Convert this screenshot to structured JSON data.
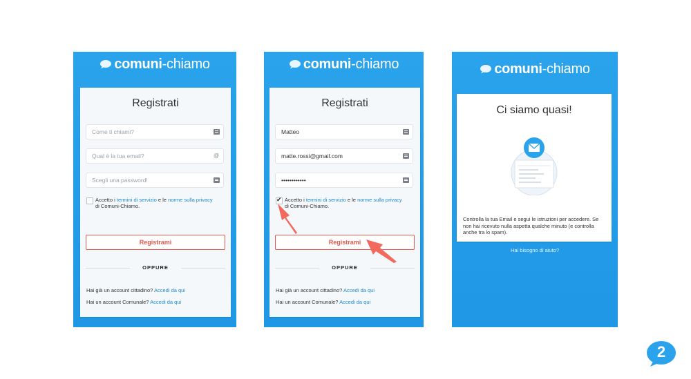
{
  "brand": {
    "part1": "comuni",
    "part2": "-chiamo"
  },
  "screen1": {
    "title": "Registrati",
    "name_placeholder": "Come ti chiami?",
    "email_placeholder": "Qual è la tua email?",
    "password_placeholder": "Scegli una password!",
    "terms_prefix": "Accetto i ",
    "terms_link": "termini di servizio",
    "terms_mid": " e le ",
    "privacy_link": "norme sulla privacy",
    "terms_suffix": "di Comuni-Chiamo.",
    "register_button": "Registrami",
    "or_label": "OPPURE",
    "citizen_text": "Hai già un account cittadino? ",
    "citizen_link": "Accedi da qui",
    "municipal_text": "Hai un account Comunale? ",
    "municipal_link": "Accedi da qui",
    "email_icon": "at-icon",
    "keychain_icon": "keychain-icon"
  },
  "screen2": {
    "title": "Registrati",
    "name_value": "Matteo",
    "email_value": "matte.rossi@gmail.com",
    "password_value": "••••••••••••",
    "terms_checked": true,
    "terms_prefix": "Accetto i ",
    "terms_link": "termini di servizio",
    "terms_mid": " e le ",
    "privacy_link": "norme sulla privacy",
    "terms_suffix": "di Comuni-Chiamo.",
    "register_button": "Registrami",
    "or_label": "OPPURE",
    "citizen_text": "Hai già un account cittadino? ",
    "citizen_link": "Accedi da qui",
    "municipal_text": "Hai un account Comunale? ",
    "municipal_link": "Accedi da qui"
  },
  "screen3": {
    "title": "Ci siamo quasi!",
    "message": "Controlla la tua Email e segui le istruzioni per accedere. Se non hai ricevuto nulla aspetta qualche minuto (e controlla anche tra lo spam).",
    "help_link": "Hai bisogno di aiuto?",
    "illustration_icon": "envelope-icon"
  },
  "step_badge": "2",
  "colors": {
    "brand_blue": "#2aa3ec",
    "accent_red": "#e4574c",
    "link_blue": "#1d88c9",
    "arrow": "#f2695e"
  }
}
